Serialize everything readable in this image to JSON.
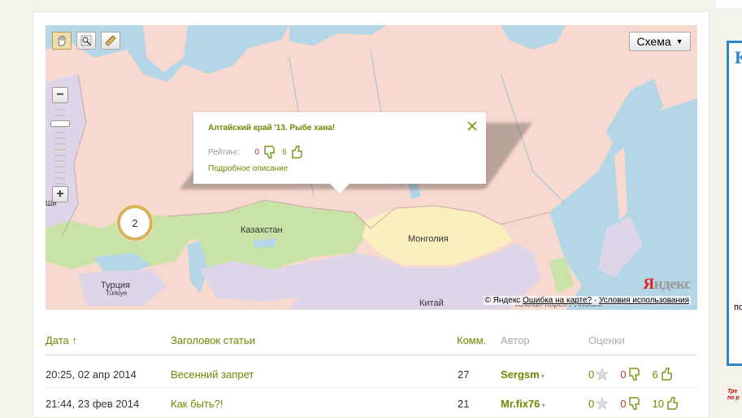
{
  "map": {
    "scheme_label": "Схема",
    "cluster_count": "2",
    "labels": {
      "kazakhstan": "Казахстан",
      "mongolia": "Монголия",
      "turkey": "Турция",
      "turkey_sub": "Türkiye",
      "china": "Китай",
      "korea": "Южная Корея / Япония",
      "shi": "Ши"
    },
    "copyright": "© Яндекс",
    "error_link": "Ошибка на карте?",
    "terms_link": "Условия использования",
    "logo_ya": "Я",
    "logo_rest": "ндекс",
    "popup": {
      "title": "Алтайский край '13. Рыбе хана!",
      "rating_label": "Рейтинг:",
      "dislikes": "0",
      "likes": "6",
      "link": "Подробное описание"
    }
  },
  "table": {
    "headers": {
      "date": "Дата",
      "date_sort": "↑",
      "title": "Заголовок статьи",
      "comments": "Комм.",
      "author": "Автор",
      "ratings": "Оценки"
    },
    "rows": [
      {
        "date": "20:25, 02 апр 2014",
        "title": "Весенний запрет",
        "comments": "27",
        "author": "Sergsm",
        "stars": "0",
        "dislikes": "0",
        "likes": "6"
      },
      {
        "date": "21:44, 23 фев 2014",
        "title": "Как быть?!",
        "comments": "21",
        "author": "Mr.fix76",
        "stars": "0",
        "dislikes": "0",
        "likes": "10"
      }
    ]
  },
  "sidebar": {
    "letter": "К",
    "text": "по",
    "red_line1": "Тре",
    "red_line2": "по р"
  },
  "colors": {
    "accent_green": "#6b8a00",
    "dislike_red": "#c0392b",
    "cluster_gold": "#d8b25a",
    "sidebar_blue": "#2d86c8"
  }
}
